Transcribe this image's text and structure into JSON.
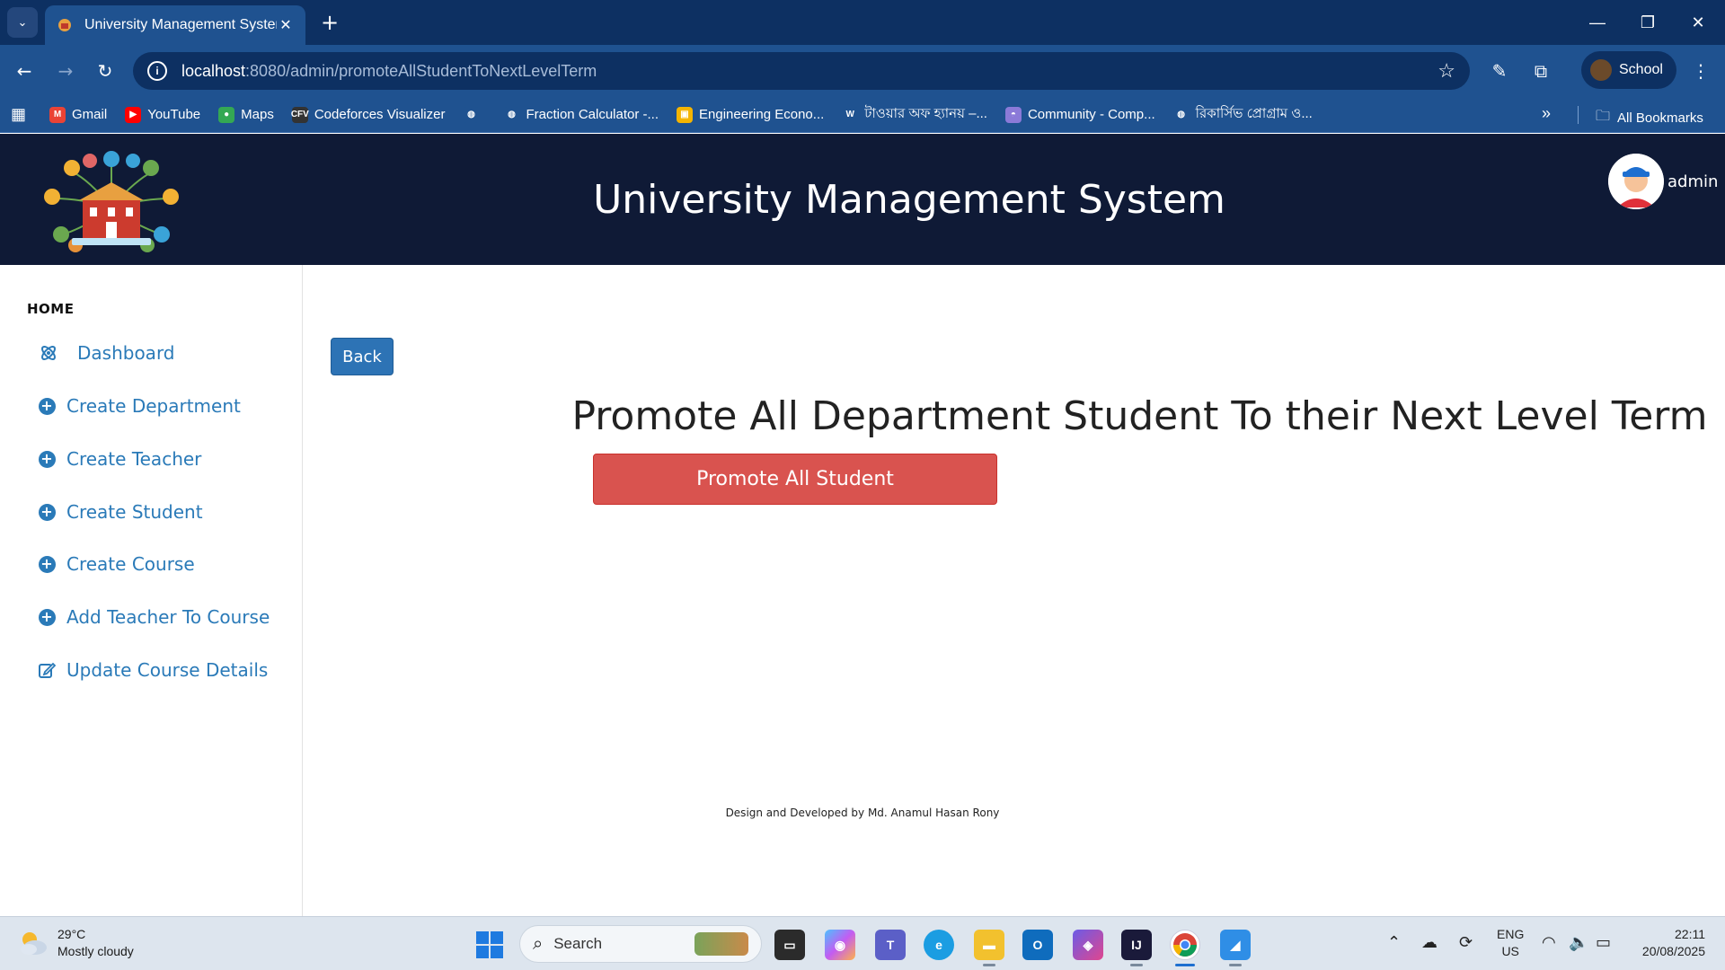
{
  "browser": {
    "tab_title": "University Management System",
    "url_host": "localhost",
    "url_rest": ":8080/admin/promoteAllStudentToNextLevelTerm",
    "profile_name": "School",
    "bookmarks": [
      {
        "label": "Gmail",
        "icon": "gmail-icon",
        "color": "#ea4335",
        "glyph": "M"
      },
      {
        "label": "YouTube",
        "icon": "youtube-icon",
        "color": "#ff0000",
        "glyph": "▶"
      },
      {
        "label": "Maps",
        "icon": "maps-icon",
        "color": "#34a853",
        "glyph": "●"
      },
      {
        "label": "Codeforces Visualizer",
        "icon": "cfv-icon",
        "color": "#333333",
        "glyph": "CFV"
      },
      {
        "label": "",
        "icon": "globe-icon",
        "color": "#1f5290",
        "glyph": "◍"
      },
      {
        "label": "Fraction Calculator -...",
        "icon": "globe-icon",
        "color": "#1f5290",
        "glyph": "◍"
      },
      {
        "label": "Engineering Econo...",
        "icon": "classroom-icon",
        "color": "#f4b400",
        "glyph": "▣"
      },
      {
        "label": "টাওয়ার অফ হ্যানয় –...",
        "icon": "wordpress-icon",
        "color": "#1f5290",
        "glyph": "W"
      },
      {
        "label": "Community - Comp...",
        "icon": "community-icon",
        "color": "#8b7ad8",
        "glyph": "◓"
      },
      {
        "label": "রিকার্সিভ প্রোগ্রাম ও...",
        "icon": "globe-icon",
        "color": "#1f5290",
        "glyph": "◍"
      }
    ],
    "all_bookmarks": "All Bookmarks"
  },
  "header": {
    "title": "University Management System",
    "user": "admin"
  },
  "sidebar": {
    "section": "HOME",
    "items": [
      {
        "label": "Dashboard",
        "icon": "dashboard-icon"
      },
      {
        "label": "Create Department",
        "icon": "plus-circle-icon"
      },
      {
        "label": "Create Teacher",
        "icon": "plus-circle-icon"
      },
      {
        "label": "Create Student",
        "icon": "plus-circle-icon"
      },
      {
        "label": "Create Course",
        "icon": "plus-circle-icon"
      },
      {
        "label": "Add Teacher To Course",
        "icon": "plus-circle-icon"
      },
      {
        "label": "Update Course Details",
        "icon": "edit-icon"
      }
    ]
  },
  "main": {
    "back_label": "Back",
    "heading": "Promote All Department Student To their Next Level Term",
    "promote_label": "Promote All Student",
    "footer": "Design and Developed by Md. Anamul Hasan Rony"
  },
  "colors": {
    "header_bg": "#0f1a36",
    "link_blue": "#2a7ab8",
    "back_btn": "#2d73b5",
    "danger_btn": "#d9534f"
  },
  "taskbar": {
    "temperature": "29°C",
    "weather": "Mostly cloudy",
    "search_placeholder": "Search",
    "lang_1": "ENG",
    "lang_2": "US",
    "time": "22:11",
    "date": "20/08/2025"
  }
}
